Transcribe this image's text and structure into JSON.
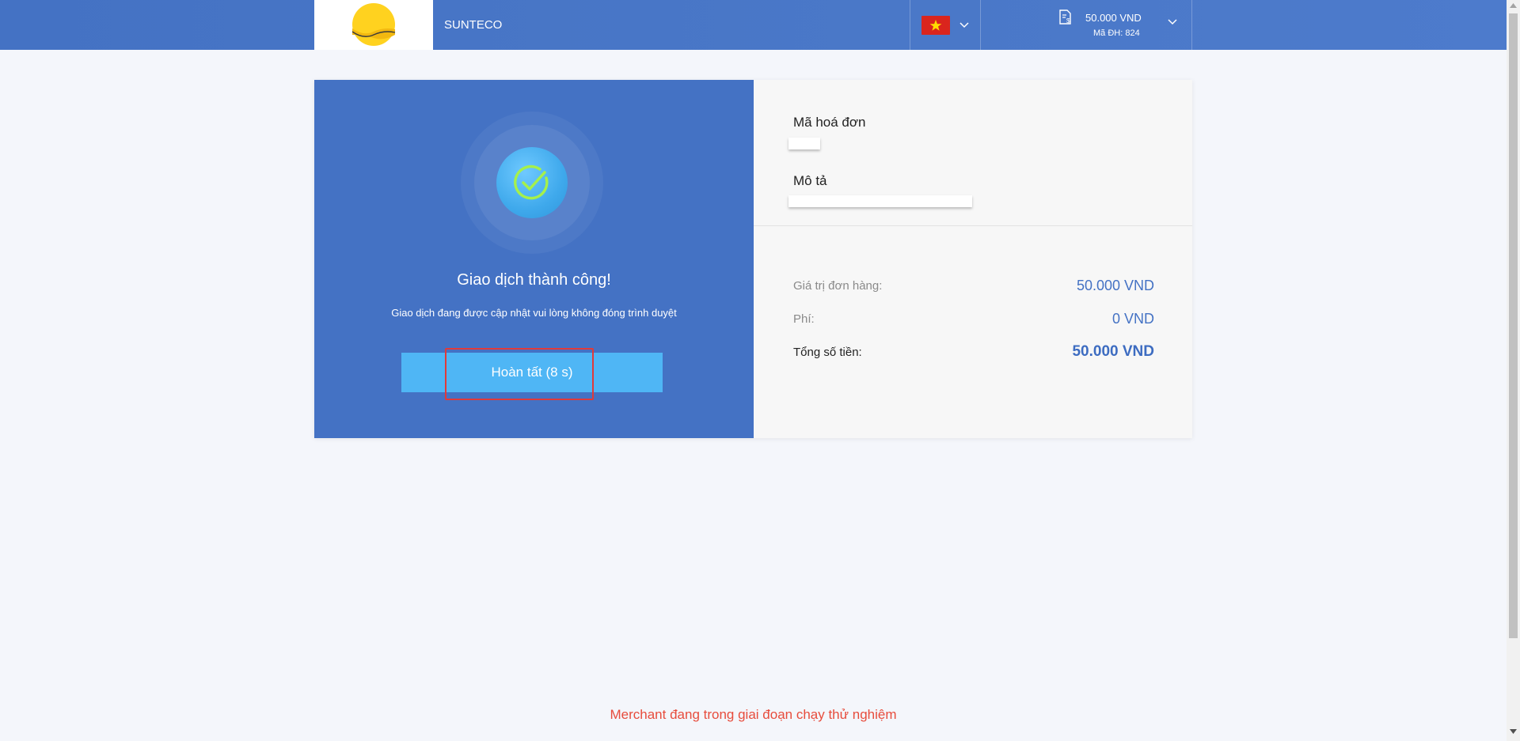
{
  "header": {
    "merchant_name": "SUNTECO",
    "order_amount": "50.000 VND",
    "order_code": "Mã ĐH:  824",
    "language": "vi",
    "flag_icon": "vietnam-flag-icon",
    "colors": {
      "header_bg": "#4472c4",
      "flag_red": "#da251d",
      "flag_star": "#ffdd00"
    }
  },
  "result": {
    "icon": "check-circle-icon",
    "title": "Giao dịch thành công!",
    "description": "Giao dịch đang được cập nhật vui lòng không đóng trình duyệt",
    "finish_button": "Hoàn tất (8 s)"
  },
  "details": {
    "invoice_label": "Mã hoá đơn",
    "description_label": "Mô tả",
    "order_value_label": "Giá trị đơn hàng:",
    "order_value": "50.000 VND",
    "fee_label": "Phí:",
    "fee": "0 VND",
    "total_label": "Tổng số tiền:",
    "total": "50.000 VND"
  },
  "footer": {
    "test_notice": "Merchant đang trong giai đoạn chạy thử nghiệm"
  }
}
